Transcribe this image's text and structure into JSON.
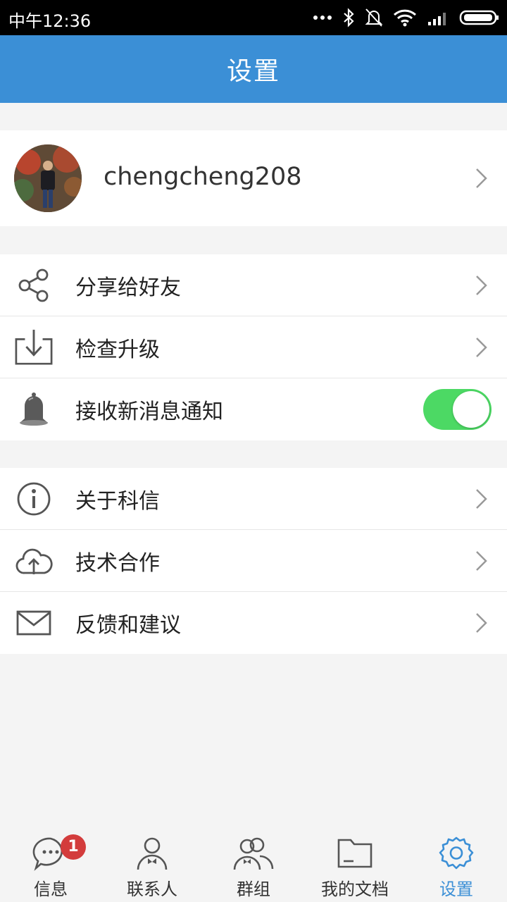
{
  "status_bar": {
    "time": "中午12:36",
    "icons": [
      "more-dots-icon",
      "bluetooth-icon",
      "bell-off-icon",
      "wifi-icon",
      "signal-icon",
      "battery-icon"
    ]
  },
  "header": {
    "title": "设置"
  },
  "profile": {
    "username": "chengcheng208",
    "avatar_icon": "avatar"
  },
  "settings_group_1": [
    {
      "label": "分享给好友",
      "icon": "share-icon"
    },
    {
      "label": "检查升级",
      "icon": "download-icon"
    },
    {
      "label": "接收新消息通知",
      "icon": "bell-icon",
      "toggle_on": true
    }
  ],
  "settings_group_2": [
    {
      "label": "关于科信",
      "icon": "info-icon"
    },
    {
      "label": "技术合作",
      "icon": "cloud-upload-icon"
    },
    {
      "label": "反馈和建议",
      "icon": "mail-icon"
    }
  ],
  "tabbar": {
    "items": [
      {
        "label": "信息",
        "icon": "chat-icon",
        "badge": "1"
      },
      {
        "label": "联系人",
        "icon": "contact-icon"
      },
      {
        "label": "群组",
        "icon": "group-icon"
      },
      {
        "label": "我的文档",
        "icon": "folder-icon"
      },
      {
        "label": "设置",
        "icon": "gear-icon",
        "active": true
      }
    ],
    "active_color": "#3b8fd6"
  },
  "colors": {
    "header_bg": "#3b8fd6",
    "toggle_on": "#4cd964",
    "badge": "#d33c3c"
  }
}
